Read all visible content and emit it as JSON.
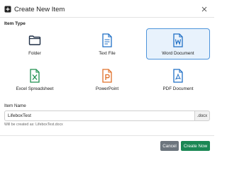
{
  "dialog": {
    "title": "Create New Item",
    "title_icon": "plus-square-icon",
    "close_icon": "close-icon"
  },
  "item_type": {
    "label": "Item Type",
    "options": [
      {
        "label": "Folder",
        "icon": "folder-icon",
        "color": "#1f2f45",
        "selected": false
      },
      {
        "label": "Text File",
        "icon": "text-file-icon",
        "color": "#1f6fc5",
        "selected": false
      },
      {
        "label": "Word Document",
        "icon": "word-document-icon",
        "color": "#1f6fc5",
        "selected": true
      },
      {
        "label": "Excel Spreadsheet",
        "icon": "excel-spreadsheet-icon",
        "color": "#1d8f4e",
        "selected": false
      },
      {
        "label": "PowerPoint",
        "icon": "powerpoint-icon",
        "color": "#e0702a",
        "selected": false
      },
      {
        "label": "PDF Document",
        "icon": "pdf-document-icon",
        "color": "#1f6fc5",
        "selected": false
      }
    ]
  },
  "item_name": {
    "label": "Item Name",
    "value": "LifeboxTest",
    "extension": ".docx",
    "hint": "Will be created as: LifeboxTest.docx"
  },
  "buttons": {
    "cancel": "Cancel",
    "create": "Create Now"
  },
  "colors": {
    "selected_bg": "#e8f2fc",
    "selected_border": "#4d94db",
    "cancel_bg": "#6c757d",
    "create_bg": "#1a8754"
  }
}
